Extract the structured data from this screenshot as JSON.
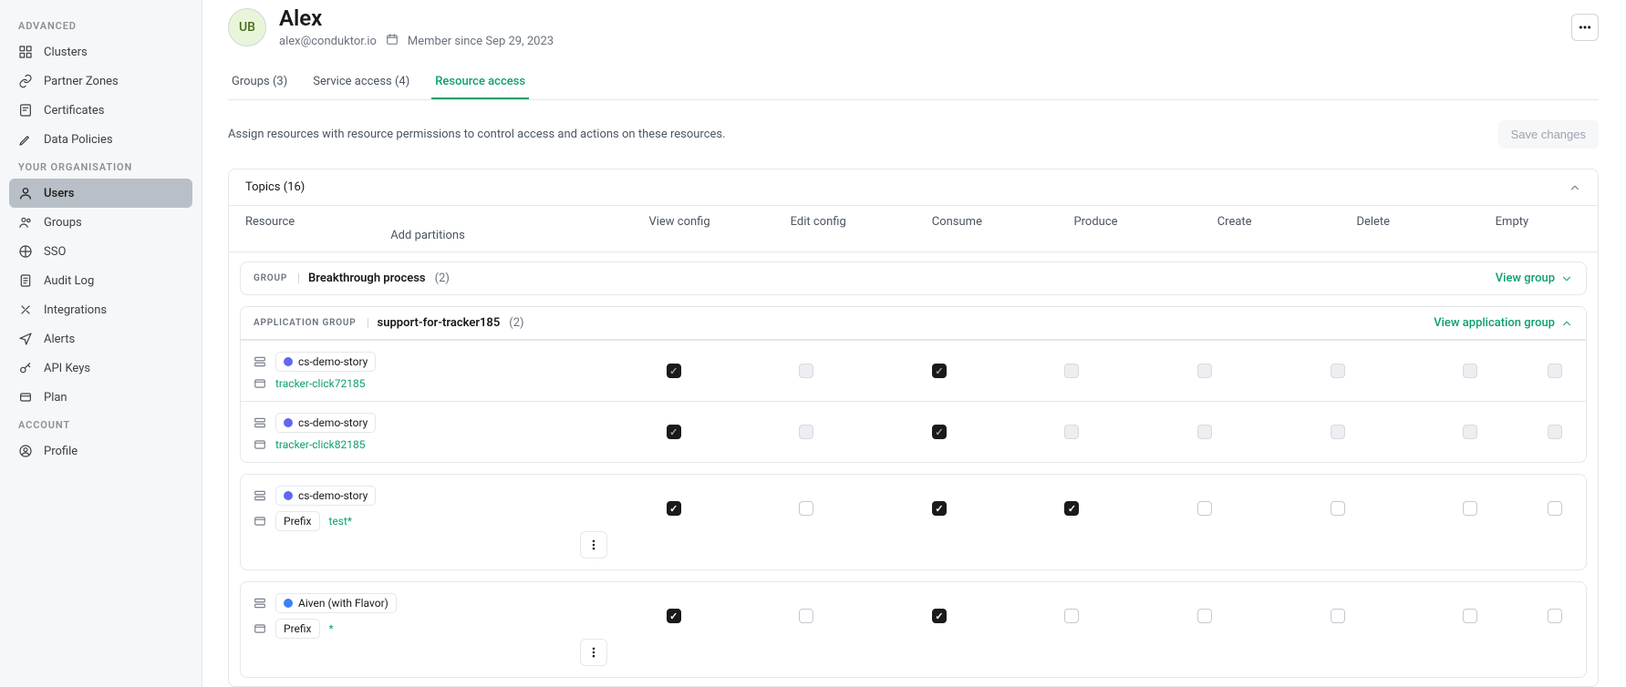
{
  "sidebar": {
    "sections": [
      {
        "title": "ADVANCED",
        "items": [
          {
            "label": "Clusters",
            "icon": "grid"
          },
          {
            "label": "Partner Zones",
            "icon": "link"
          },
          {
            "label": "Certificates",
            "icon": "cert"
          },
          {
            "label": "Data Policies",
            "icon": "pen"
          }
        ]
      },
      {
        "title": "YOUR ORGANISATION",
        "items": [
          {
            "label": "Users",
            "icon": "user",
            "active": true
          },
          {
            "label": "Groups",
            "icon": "users"
          },
          {
            "label": "SSO",
            "icon": "sso"
          },
          {
            "label": "Audit Log",
            "icon": "log"
          },
          {
            "label": "Integrations",
            "icon": "integ"
          },
          {
            "label": "Alerts",
            "icon": "alert"
          },
          {
            "label": "API Keys",
            "icon": "key"
          },
          {
            "label": "Plan",
            "icon": "plan"
          }
        ]
      },
      {
        "title": "ACCOUNT",
        "items": [
          {
            "label": "Profile",
            "icon": "profile"
          }
        ]
      }
    ]
  },
  "user": {
    "avatar": "UB",
    "name": "Alex",
    "email": "alex@conduktor.io",
    "member_since": "Member since Sep 29, 2023"
  },
  "tabs": [
    {
      "label": "Groups (3)"
    },
    {
      "label": "Service access (4)"
    },
    {
      "label": "Resource access",
      "active": true
    }
  ],
  "description": "Assign resources with resource permissions to control access and actions on these resources.",
  "save_label": "Save changes",
  "panel": {
    "title": "Topics (16)",
    "columns": [
      "Resource",
      "View config",
      "Edit config",
      "Consume",
      "Produce",
      "Create",
      "Delete",
      "Empty",
      "Add partitions"
    ]
  },
  "group_badge": "GROUP",
  "app_group_badge": "APPLICATION GROUP",
  "view_group": "View group",
  "view_app_group": "View application group",
  "prefix_label": "Prefix",
  "group1": {
    "name": "Breakthrough process",
    "count": "(2)"
  },
  "app_group": {
    "name": "support-for-tracker185",
    "count": "(2)",
    "rows": [
      {
        "cluster": "cs-demo-story",
        "resource": "tracker-click72185",
        "perms": [
          "checked-disabled",
          "disabled",
          "checked-disabled",
          "disabled",
          "disabled",
          "disabled",
          "disabled",
          "disabled"
        ]
      },
      {
        "cluster": "cs-demo-story",
        "resource": "tracker-click82185",
        "perms": [
          "checked-disabled",
          "disabled",
          "checked-disabled",
          "disabled",
          "disabled",
          "disabled",
          "disabled",
          "disabled"
        ]
      }
    ]
  },
  "loose_rows": [
    {
      "cluster": "cs-demo-story",
      "dot": "default",
      "prefix": "test*",
      "perms": [
        "checked",
        "",
        "checked",
        "checked",
        "",
        "",
        "",
        ""
      ]
    },
    {
      "cluster": "Aiven (with Flavor)",
      "dot": "alt",
      "prefix": "*",
      "perms": [
        "checked",
        "",
        "checked",
        "",
        "",
        "",
        "",
        ""
      ]
    }
  ]
}
